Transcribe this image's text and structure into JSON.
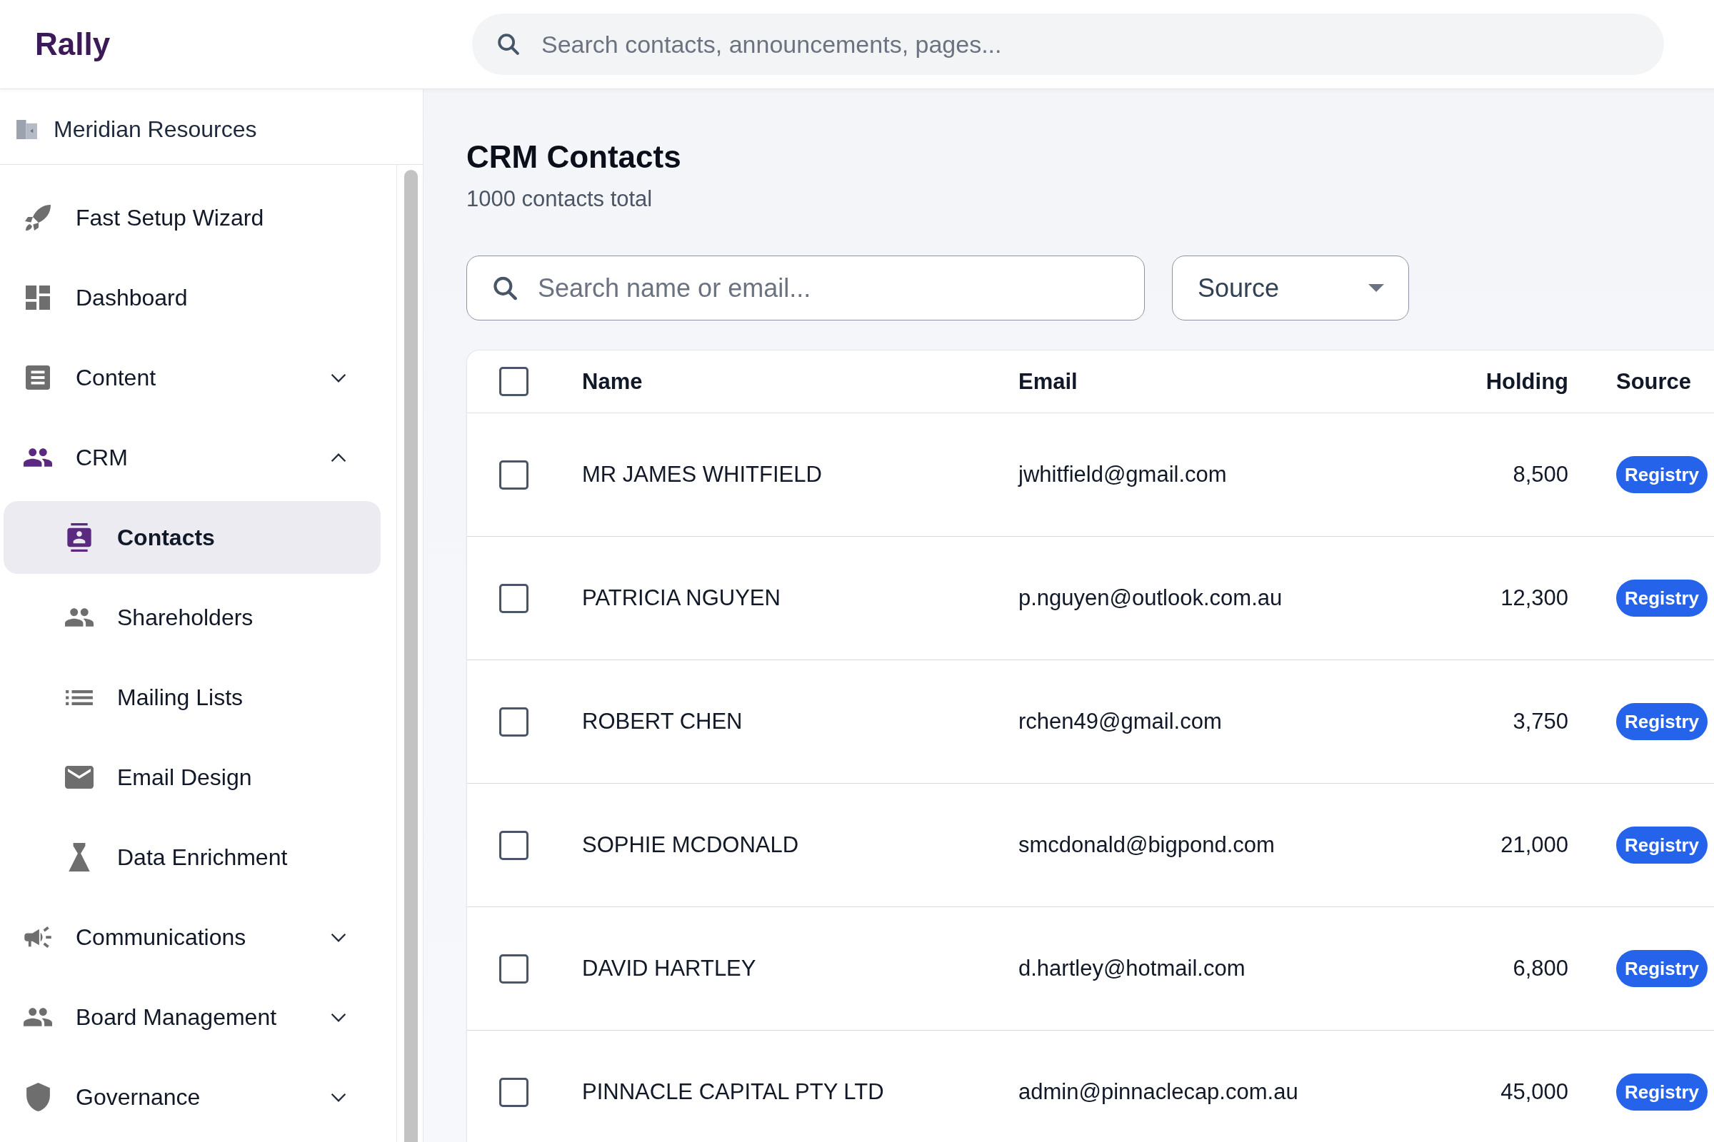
{
  "topbar": {
    "logo": "Rally",
    "search": {
      "placeholder": "Search contacts, announcements, pages..."
    }
  },
  "sidebar": {
    "workspace": "Meridian Resources",
    "items": [
      {
        "kind": "link",
        "label": "Fast Setup Wizard",
        "selected": false
      },
      {
        "kind": "link",
        "label": "Dashboard",
        "selected": false
      },
      {
        "kind": "group",
        "label": "Content",
        "selected": false,
        "expanded": false
      },
      {
        "kind": "group",
        "label": "CRM",
        "selected": false,
        "expanded": true,
        "children": [
          {
            "label": "Contacts",
            "selected": true
          },
          {
            "label": "Shareholders",
            "selected": false
          },
          {
            "label": "Mailing Lists",
            "selected": false
          },
          {
            "label": "Email Design",
            "selected": false
          },
          {
            "label": "Data Enrichment",
            "selected": false
          }
        ]
      },
      {
        "kind": "group",
        "label": "Communications",
        "selected": false,
        "expanded": false
      },
      {
        "kind": "group",
        "label": "Board Management",
        "selected": false,
        "expanded": false
      },
      {
        "kind": "group",
        "label": "Governance",
        "selected": false,
        "expanded": false
      }
    ]
  },
  "page": {
    "title": "CRM Contacts",
    "subtitle": "1000 contacts total",
    "search": {
      "placeholder": "Search name or email..."
    },
    "source_filter": {
      "label": "Source"
    }
  },
  "table": {
    "select_all": {
      "checked": false
    },
    "columns": [
      "Name",
      "Email",
      "Holding",
      "Source"
    ],
    "rows": [
      {
        "checked": false,
        "name": "MR JAMES WHITFIELD",
        "email": "jwhitfield@gmail.com",
        "holding": "8,500",
        "source": "Registry"
      },
      {
        "checked": false,
        "name": "PATRICIA NGUYEN",
        "email": "p.nguyen@outlook.com.au",
        "holding": "12,300",
        "source": "Registry"
      },
      {
        "checked": false,
        "name": "ROBERT CHEN",
        "email": "rchen49@gmail.com",
        "holding": "3,750",
        "source": "Registry"
      },
      {
        "checked": false,
        "name": "SOPHIE MCDONALD",
        "email": "smcdonald@bigpond.com",
        "holding": "21,000",
        "source": "Registry"
      },
      {
        "checked": false,
        "name": "DAVID HARTLEY",
        "email": "d.hartley@hotmail.com",
        "holding": "6,800",
        "source": "Registry"
      },
      {
        "checked": false,
        "name": "PINNACLE CAPITAL PTY LTD",
        "email": "admin@pinnaclecap.com.au",
        "holding": "45,000",
        "source": "Registry"
      }
    ]
  }
}
